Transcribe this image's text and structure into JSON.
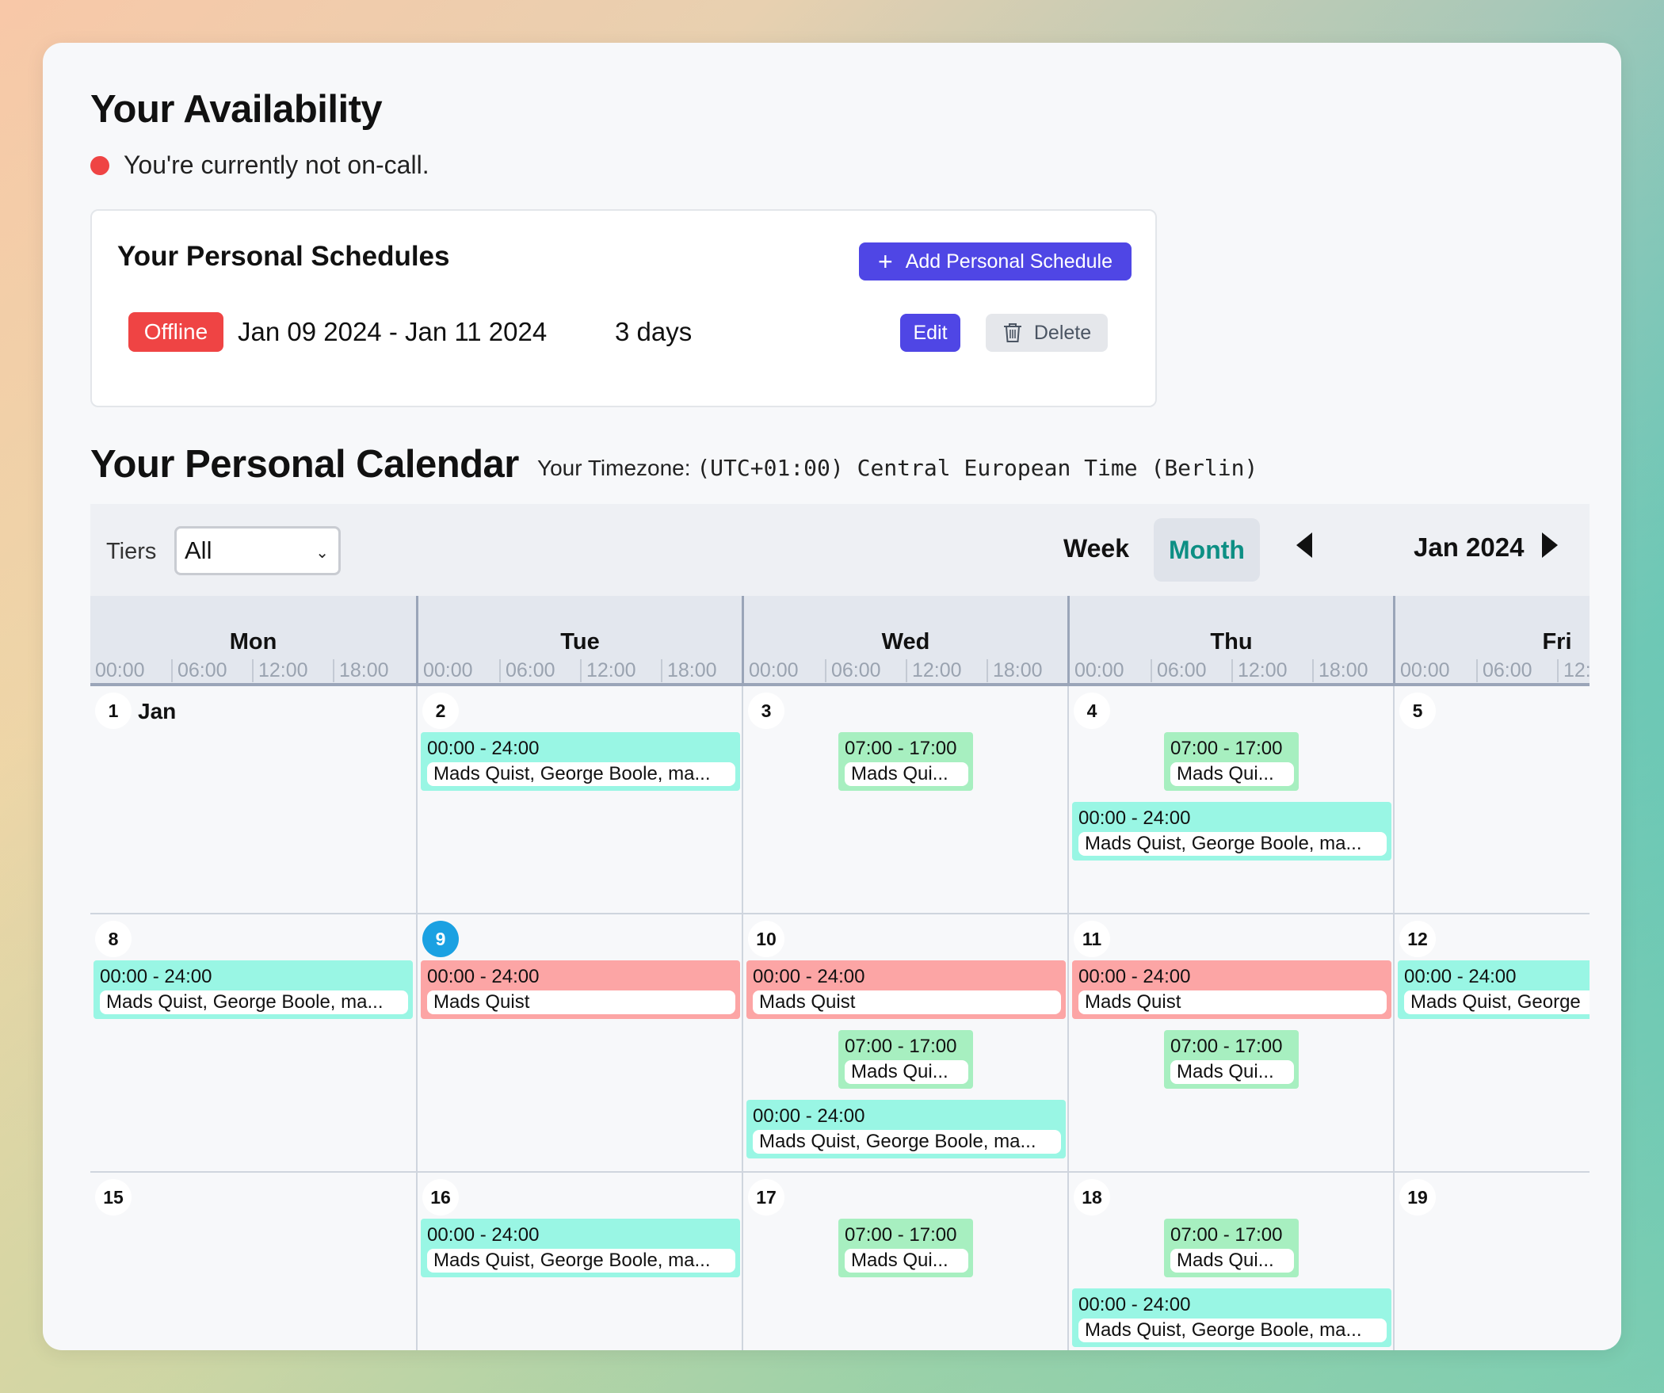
{
  "availability": {
    "title": "Your Availability",
    "status_text": "You're currently not on-call.",
    "status_color": "#ef4444"
  },
  "personal_schedules": {
    "title": "Your Personal Schedules",
    "add_button": "Add Personal Schedule",
    "items": [
      {
        "badge": "Offline",
        "range": "Jan 09 2024 - Jan 11 2024",
        "duration": "3 days",
        "edit_label": "Edit",
        "delete_label": "Delete"
      }
    ]
  },
  "calendar": {
    "title": "Your Personal Calendar",
    "timezone_label": "Your Timezone:",
    "timezone_value": "(UTC+01:00) Central European Time (Berlin)",
    "tiers_label": "Tiers",
    "tiers_selected": "All",
    "view_week": "Week",
    "view_month": "Month",
    "current_month": "Jan 2024",
    "accent_color": "#0d8f84",
    "days": [
      {
        "name": "Mon",
        "hours": [
          "00:00",
          "06:00",
          "12:00",
          "18:00"
        ]
      },
      {
        "name": "Tue",
        "hours": [
          "00:00",
          "06:00",
          "12:00",
          "18:00"
        ]
      },
      {
        "name": "Wed",
        "hours": [
          "00:00",
          "06:00",
          "12:00",
          "18:00"
        ]
      },
      {
        "name": "Thu",
        "hours": [
          "00:00",
          "06:00",
          "12:00",
          "18:00"
        ]
      },
      {
        "name": "Fri",
        "hours": [
          "00:00",
          "06:00",
          "12:"
        ]
      }
    ],
    "weeks": [
      {
        "dates": [
          "1",
          "2",
          "3",
          "4",
          "5"
        ],
        "month_marker": "Jan"
      },
      {
        "dates": [
          "8",
          "9",
          "10",
          "11",
          "12"
        ],
        "today": "9"
      },
      {
        "dates": [
          "15",
          "16",
          "17",
          "18",
          "19"
        ]
      }
    ],
    "events": {
      "full_day_time": "00:00 - 24:00",
      "work_time": "07:00 - 17:00",
      "team_names": "Mads Quist, George Boole, ma...",
      "team_names_cut": "Mads Quist, George",
      "work_names": "Mads Qui...",
      "offline_names": "Mads Quist"
    }
  }
}
